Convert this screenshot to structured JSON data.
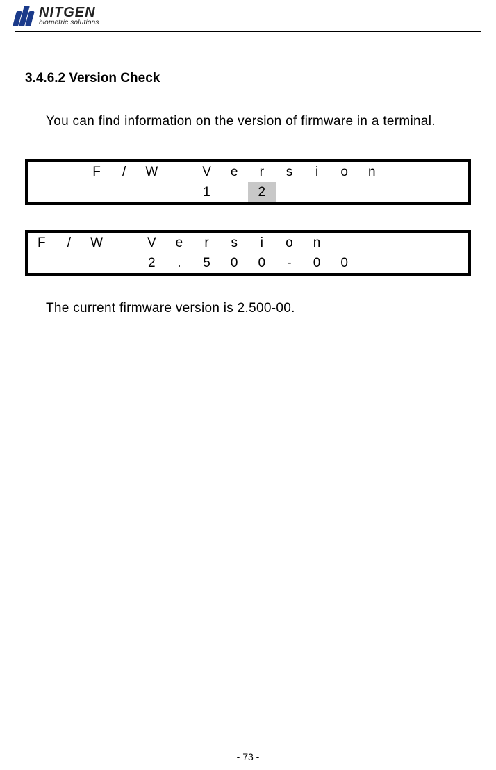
{
  "brand": {
    "main": "NITGEN",
    "sub": "biometric solutions"
  },
  "section": {
    "heading": "3.4.6.2 Version Check",
    "intro": "You can find information on the version of firmware in a terminal.",
    "result_text": "The current firmware version is 2.500-00."
  },
  "lcd1": {
    "row1": [
      "",
      "",
      "F",
      "/",
      "W",
      "",
      "V",
      "e",
      "r",
      "s",
      "i",
      "o",
      "n",
      "",
      "",
      ""
    ],
    "row2": [
      "",
      "",
      "",
      "",
      "",
      "",
      "1",
      "",
      "2",
      "",
      "",
      "",
      "",
      "",
      "",
      ""
    ],
    "highlight_row2_index": 8
  },
  "lcd2": {
    "row1": [
      "F",
      "/",
      "W",
      "",
      "V",
      "e",
      "r",
      "s",
      "i",
      "o",
      "n",
      "",
      "",
      "",
      "",
      ""
    ],
    "row2": [
      "",
      "",
      "",
      "",
      "2",
      ".",
      "5",
      "0",
      "0",
      "-",
      "0",
      "0",
      "",
      "",
      "",
      ""
    ]
  },
  "page_number": "- 73 -"
}
